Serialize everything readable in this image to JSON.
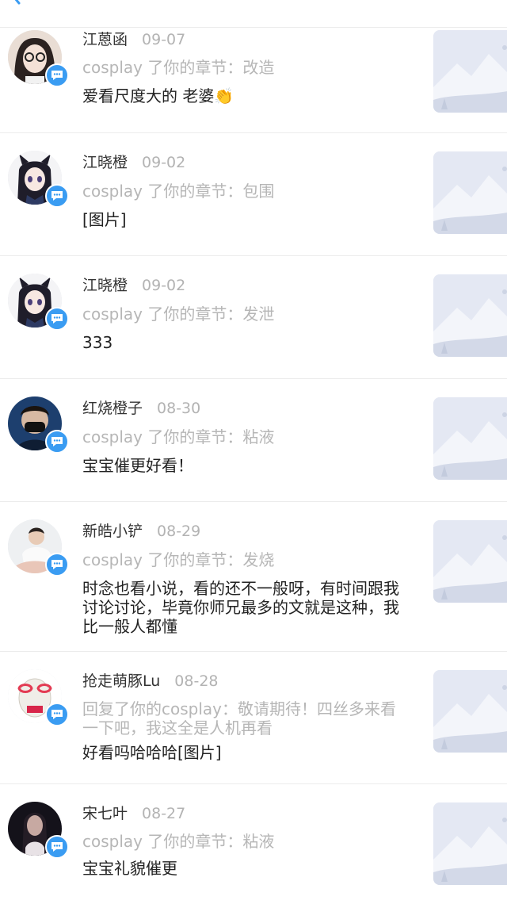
{
  "header": {
    "back_icon": "back-arrow-icon",
    "accent": "#3a9cf2"
  },
  "colors": {
    "badge": "#3a9cf2",
    "name": "#333333",
    "date": "#b3b3b3",
    "action": "#b6b6b6",
    "comment": "#222222",
    "thumb_bg": "#e4e8f3"
  },
  "notifications": [
    {
      "name": "江蒽函",
      "date": "09-07",
      "action": "cosplay 了你的章节：改造",
      "comment": "爱看尺度大的 老婆",
      "emoji": "👏",
      "avatar": "avatar-girl-glasses"
    },
    {
      "name": "江晓橙",
      "date": "09-02",
      "action": "cosplay 了你的章节：包围",
      "comment": "[图片]",
      "avatar": "avatar-anime-girl"
    },
    {
      "name": "江晓橙",
      "date": "09-02",
      "action": "cosplay 了你的章节：发泄",
      "comment": "333",
      "avatar": "avatar-anime-girl"
    },
    {
      "name": "红烧橙子",
      "date": "08-30",
      "action": "cosplay 了你的章节：粘液",
      "comment": "宝宝催更好看！",
      "avatar": "avatar-masked-person"
    },
    {
      "name": "新皓小铲",
      "date": "08-29",
      "action": "cosplay 了你的章节：发烧",
      "comment": "时念也看小说，看的还不一般呀，有时间跟我讨论讨论，毕竟你师兄最多的文就是这种，我比一般人都懂",
      "avatar": "avatar-boy-sitting"
    },
    {
      "name": "抢走萌豚Lu",
      "date": "08-28",
      "action": "回复了你的cosplay：敬请期待！四丝多来看一下吧，我这全是人机再看",
      "comment": "好看吗哈哈哈[图片]",
      "avatar": "avatar-meme-face"
    },
    {
      "name": "宋七叶",
      "date": "08-27",
      "action": "cosplay 了你的章节：粘液",
      "comment": "宝宝礼貌催更",
      "avatar": "avatar-dark-portrait"
    }
  ]
}
